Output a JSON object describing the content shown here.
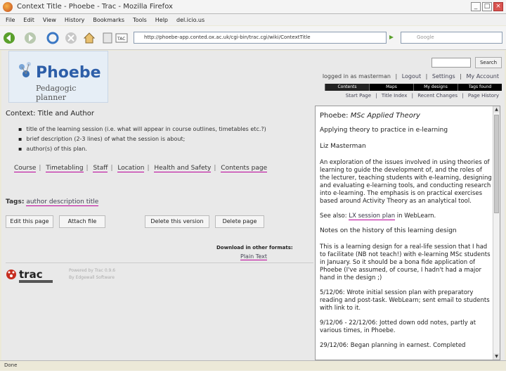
{
  "window": {
    "title": "Context Title - Phoebe - Trac - Mozilla Firefox"
  },
  "menu": [
    "File",
    "Edit",
    "View",
    "History",
    "Bookmarks",
    "Tools",
    "Help",
    "del.icio.us"
  ],
  "nav": {
    "url": "http://phoebe-app.conted.ox.ac.uk/cgi-bin/trac.cgi/wiki/ContextTitle",
    "search_placeholder": "Google"
  },
  "header": {
    "logo_name": "Phoebe",
    "logo_sub": "Pedagogic planner",
    "search_button": "Search",
    "metanav": [
      "logged in as masterman",
      "|",
      "Logout",
      "|",
      "Settings",
      "|",
      "My Account"
    ],
    "mainnav": [
      "Contents",
      "Maps",
      "My designs",
      "Tags found"
    ],
    "ctxnav": [
      "Start Page",
      "|",
      "Title Index",
      "|",
      "Recent Changes",
      "|",
      "Page History"
    ]
  },
  "content": {
    "title": "Context: Title and Author",
    "bullets": [
      "title of the learning session (i.e. what will appear in course outlines, timetables etc.?)",
      "brief description (2-3 lines) of what the session is about;",
      "author(s) of this plan."
    ],
    "links": [
      "Course",
      "Timetabling",
      "Staff",
      "Location",
      "Health and Safety",
      "Contents page"
    ],
    "tags_label": "Tags:",
    "tags_value": "author description title",
    "buttons": [
      "Edit this page",
      "Attach file",
      "Delete this version",
      "Delete page"
    ],
    "download_label": "Download in other formats:",
    "plain_text": "Plain Text",
    "powered_by": "Powered by Trac 0.9.6",
    "powered_sub": "By Edgewall Software"
  },
  "side": {
    "heading_prefix": "Phoebe: ",
    "heading_italic": "MSc Applied Theory",
    "subtitle": "Applying theory to practice in e-learning",
    "author": "Liz Masterman",
    "desc": "An exploration of the issues involved in using theories of learning to guide the development of, and the roles of the lecturer, teaching students with e-learning, designing and evaluating e-learning tools, and conducting research into e-learning. The emphasis is on practical exercises based around Activity Theory as an analytical tool.",
    "see_also_prefix": "See also: ",
    "see_also_link": "LX session plan",
    "see_also_suffix": " in WebLearn.",
    "notes_heading": "Notes on the history of this learning design",
    "notes_p1": "This is a learning design for a real-life session that I had to facilitate (NB not teach!) with e-learning MSc students in January. So it should be a bona fide application of Phoebe (I've assumed, of course, I hadn't had a major hand in the design ;)",
    "notes_p2": "5/12/06: Wrote initial session plan with preparatory reading and post-task. WebLearn; sent email to students with link to it.",
    "notes_p3": "9/12/06 - 22/12/06: Jotted down odd notes, partly at various times, in Phoebe.",
    "notes_p4": "29/12/06: Began planning in earnest. Completed"
  },
  "status": {
    "text": "Done"
  }
}
